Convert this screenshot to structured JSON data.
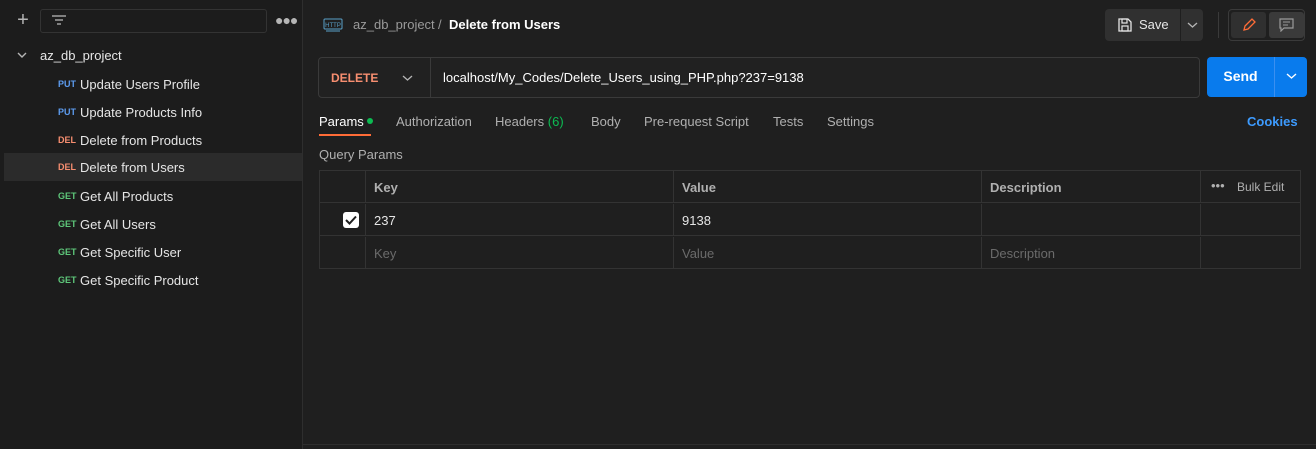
{
  "sidebar": {
    "collection_name": "az_db_project",
    "requests": [
      {
        "method": "PUT",
        "label": "Update Users Profile",
        "color": "#5d9cf0"
      },
      {
        "method": "PUT",
        "label": "Update Products Info",
        "color": "#5d9cf0"
      },
      {
        "method": "DEL",
        "label": "Delete from Products",
        "color": "#f78e70"
      },
      {
        "method": "DEL",
        "label": "Delete from Users",
        "color": "#f78e70"
      },
      {
        "method": "GET",
        "label": "Get All Products",
        "color": "#5ec77a"
      },
      {
        "method": "GET",
        "label": "Get All Users",
        "color": "#5ec77a"
      },
      {
        "method": "GET",
        "label": "Get Specific User",
        "color": "#5ec77a"
      },
      {
        "method": "GET",
        "label": "Get Specific Product",
        "color": "#5ec77a"
      }
    ]
  },
  "header": {
    "icon_text": "HTTP",
    "collection": "az_db_project",
    "separator": "/",
    "title": "Delete from Users",
    "save_label": "Save"
  },
  "request": {
    "method": "DELETE",
    "url": "localhost/My_Codes/Delete_Users_using_PHP.php?237=9138",
    "send_label": "Send"
  },
  "tabs": {
    "params": "Params",
    "authorization": "Authorization",
    "headers": "Headers",
    "headers_count": "(6)",
    "body": "Body",
    "prerequest": "Pre-request Script",
    "tests": "Tests",
    "settings": "Settings",
    "cookies": "Cookies"
  },
  "params": {
    "section_label": "Query Params",
    "columns": {
      "key": "Key",
      "value": "Value",
      "description": "Description",
      "bulk_edit": "Bulk Edit"
    },
    "rows": [
      {
        "checked": true,
        "key": "237",
        "value": "9138",
        "description": ""
      }
    ],
    "placeholders": {
      "key": "Key",
      "value": "Value",
      "description": "Description"
    }
  },
  "colors": {
    "accent_orange": "#ff6c37",
    "send_blue": "#097bed",
    "delete_red": "#f78e70",
    "green": "#0cbb52"
  }
}
